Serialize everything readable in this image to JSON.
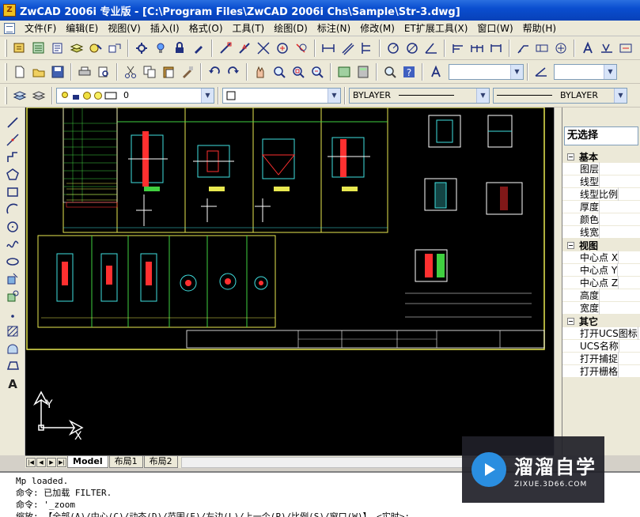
{
  "window": {
    "title": "ZwCAD 2006i 专业版 - [C:\\Program Files\\ZwCAD 2006i Chs\\Sample\\Str-3.dwg]",
    "app_icon": "Z"
  },
  "menu": [
    "文件(F)",
    "编辑(E)",
    "视图(V)",
    "插入(I)",
    "格式(O)",
    "工具(T)",
    "绘图(D)",
    "标注(N)",
    "修改(M)",
    "ET扩展工具(X)",
    "窗口(W)",
    "帮助(H)"
  ],
  "toolbar_layer": {
    "layer_value": "0",
    "linetype_value": "BYLAYER",
    "lineweight_value": "BYLAYER"
  },
  "left_toolbar_icons": [
    "line-icon",
    "construction-line-icon",
    "polyline-icon",
    "polygon-icon",
    "rectangle-icon",
    "arc-icon",
    "circle-icon",
    "spline-icon",
    "ellipse-icon",
    "insert-block-icon",
    "make-block-icon",
    "point-icon",
    "hatch-icon",
    "region-icon",
    "revision-cloud-icon",
    "text-icon"
  ],
  "properties": {
    "selection": "无选择",
    "groups": [
      {
        "name": "基本",
        "items": [
          "图层",
          "线型",
          "线型比例",
          "厚度",
          "颜色",
          "线宽"
        ]
      },
      {
        "name": "视图",
        "items": [
          "中心点 X",
          "中心点 Y",
          "中心点 Z",
          "高度",
          "宽度"
        ]
      },
      {
        "name": "其它",
        "items": [
          "打开UCS图标",
          "UCS名称",
          "打开捕捉",
          "打开栅格"
        ]
      }
    ]
  },
  "layout_tabs": [
    "Model",
    "布局1",
    "布局2"
  ],
  "ucs": {
    "x_label": "X",
    "y_label": "Y"
  },
  "command_lines": [
    "Mp loaded.",
    "命令:   已加载 FILTER.",
    "命令: '_zoom",
    "缩放: 【全部(A)/中心(C)/动态(D)/范围(E)/左边(L)/上一个(P)/比例(S)/窗口(W)】 <实时>:"
  ],
  "watermark": {
    "title": "溜溜自学",
    "url": "ZIXUE.3D66.COM"
  },
  "colors": {
    "canvas": "#000000",
    "frame": "#e8e850",
    "cyan": "#40e0e0",
    "red": "#ff3030",
    "white": "#ffffff",
    "green": "#40d040"
  }
}
